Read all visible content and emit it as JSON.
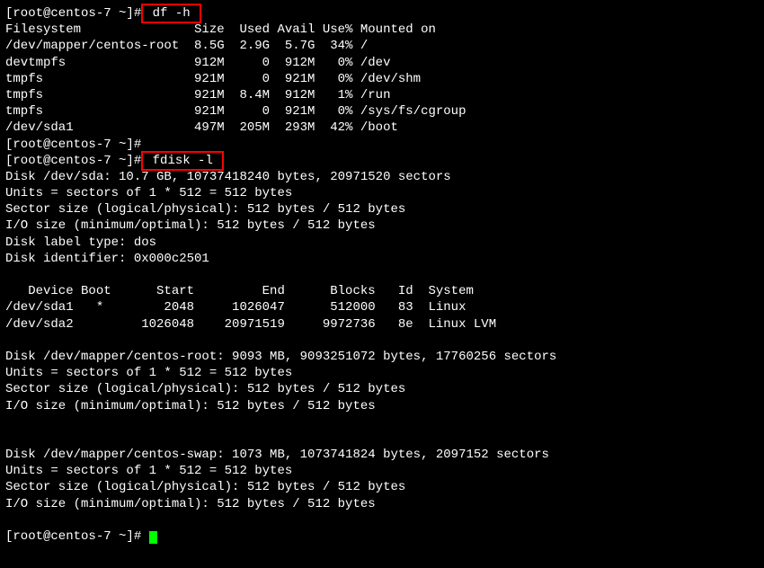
{
  "prompt": {
    "user": "root",
    "host": "centos-7",
    "path": "~",
    "symbol": "#"
  },
  "commands": {
    "cmd1": " df -h ",
    "cmd2": " fdisk -l "
  },
  "df": {
    "header": "Filesystem               Size  Used Avail Use% Mounted on",
    "rows": [
      "/dev/mapper/centos-root  8.5G  2.9G  5.7G  34% /",
      "devtmpfs                 912M     0  912M   0% /dev",
      "tmpfs                    921M     0  921M   0% /dev/shm",
      "tmpfs                    921M  8.4M  912M   1% /run",
      "tmpfs                    921M     0  921M   0% /sys/fs/cgroup",
      "/dev/sda1                497M  205M  293M  42% /boot"
    ]
  },
  "fdisk": {
    "sda": {
      "header": "Disk /dev/sda: 10.7 GB, 10737418240 bytes, 20971520 sectors",
      "units": "Units = sectors of 1 * 512 = 512 bytes",
      "sector": "Sector size (logical/physical): 512 bytes / 512 bytes",
      "io": "I/O size (minimum/optimal): 512 bytes / 512 bytes",
      "label": "Disk label type: dos",
      "ident": "Disk identifier: 0x000c2501",
      "part_header": "   Device Boot      Start         End      Blocks   Id  System",
      "parts": [
        "/dev/sda1   *        2048     1026047      512000   83  Linux",
        "/dev/sda2         1026048    20971519     9972736   8e  Linux LVM"
      ]
    },
    "root": {
      "header": "Disk /dev/mapper/centos-root: 9093 MB, 9093251072 bytes, 17760256 sectors",
      "units": "Units = sectors of 1 * 512 = 512 bytes",
      "sector": "Sector size (logical/physical): 512 bytes / 512 bytes",
      "io": "I/O size (minimum/optimal): 512 bytes / 512 bytes"
    },
    "swap": {
      "header": "Disk /dev/mapper/centos-swap: 1073 MB, 1073741824 bytes, 2097152 sectors",
      "units": "Units = sectors of 1 * 512 = 512 bytes",
      "sector": "Sector size (logical/physical): 512 bytes / 512 bytes",
      "io": "I/O size (minimum/optimal): 512 bytes / 512 bytes"
    }
  },
  "empty_prompt": "[root@centos-7 ~]#",
  "prompt_full": "[root@centos-7 ~]# ",
  "blank": ""
}
